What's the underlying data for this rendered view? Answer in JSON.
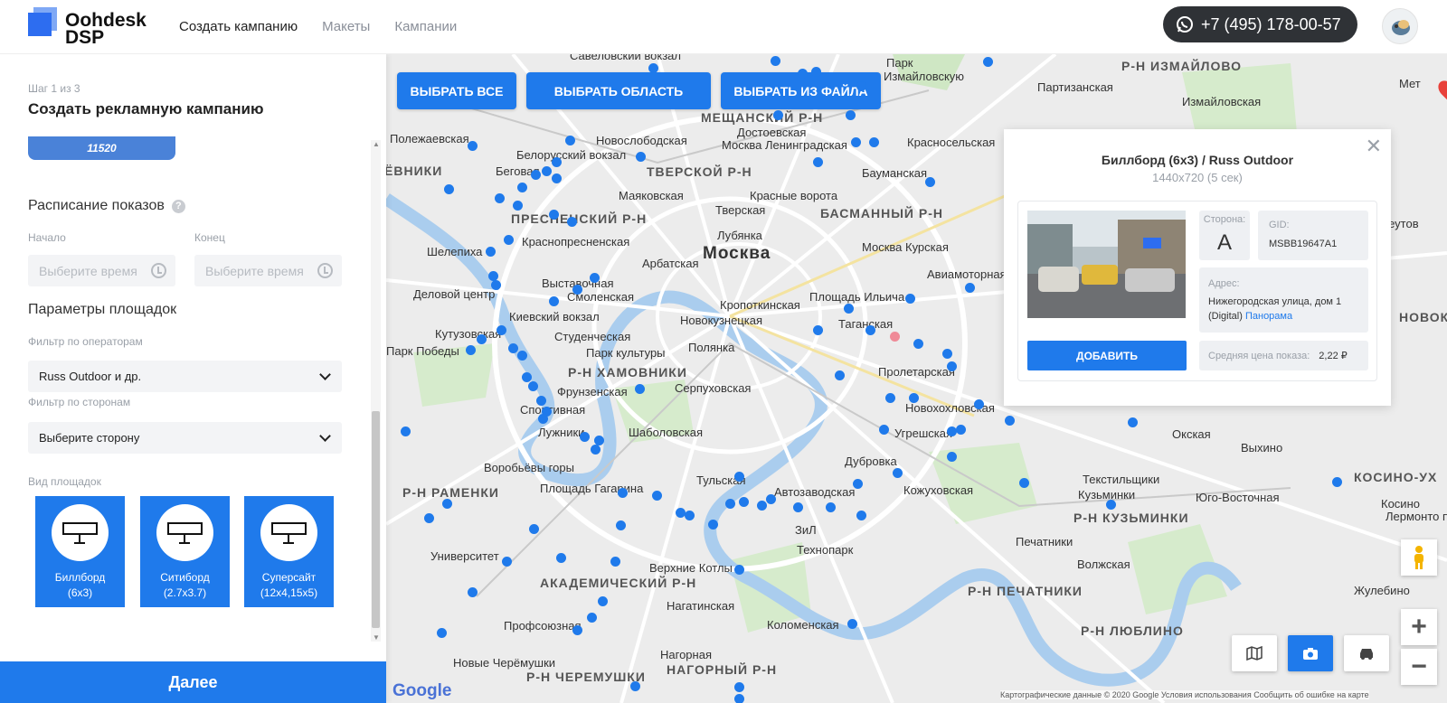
{
  "header": {
    "logo_line1": "Oohdesk",
    "logo_line2": "DSP",
    "nav": [
      {
        "label": "Создать кампанию"
      },
      {
        "label": "Макеты"
      },
      {
        "label": "Кампании"
      }
    ],
    "phone": "+7 (495) 178-00-57"
  },
  "sidebar": {
    "step": "Шаг 1 из 3",
    "title": "Создать рекламную кампанию",
    "budget_value": "11520",
    "schedule": {
      "title": "Расписание показов",
      "start_label": "Начало",
      "end_label": "Конец",
      "start_placeholder": "Выберите время",
      "end_placeholder": "Выберите время"
    },
    "params": {
      "title": "Параметры площадок",
      "operator_label": "Фильтр по операторам",
      "operator_value": "Russ Outdoor и др.",
      "side_label": "Фильтр по сторонам",
      "side_value": "Выберите сторону",
      "types_label": "Вид площадок",
      "types": [
        {
          "line1": "Биллборд",
          "line2": "(6x3)"
        },
        {
          "line1": "Ситиборд",
          "line2": "(2.7x3.7)"
        },
        {
          "line1": "Суперсайт",
          "line2": "(12x4,15x5)"
        }
      ]
    },
    "next_button": "Далее"
  },
  "map": {
    "buttons": {
      "select_all": "ВЫБРАТЬ ВСЕ",
      "select_area": "ВЫБРАТЬ ОБЛАСТЬ",
      "select_file": "ВЫБРАТЬ ИЗ ФАЙЛА"
    },
    "labels": [
      {
        "text": "Савеловский вокзал",
        "kind": "station"
      },
      {
        "text": "Р-Н ИЗМАЙЛОВО",
        "kind": "district"
      },
      {
        "text": "Парк",
        "kind": "station"
      },
      {
        "text": "Измайловскую",
        "kind": "station"
      },
      {
        "text": "Партизанская",
        "kind": "station"
      },
      {
        "text": "Измайловская",
        "kind": "station"
      },
      {
        "text": "МЕЩАНСКИЙ Р-Н",
        "kind": "district"
      },
      {
        "text": "Полежаевская",
        "kind": "station"
      },
      {
        "text": "Новослободская",
        "kind": "station"
      },
      {
        "text": "Достоевская",
        "kind": "station"
      },
      {
        "text": "Белорусский вокзал",
        "kind": "station"
      },
      {
        "text": "Москва Ленинградская",
        "kind": "station"
      },
      {
        "text": "Красносельская",
        "kind": "station"
      },
      {
        "text": "ЁВНИКИ",
        "kind": "district"
      },
      {
        "text": "Беговая",
        "kind": "station"
      },
      {
        "text": "ТВЕРСКОЙ Р-Н",
        "kind": "district"
      },
      {
        "text": "Бауманская",
        "kind": "station"
      },
      {
        "text": "Маяковская",
        "kind": "station"
      },
      {
        "text": "Красные ворота",
        "kind": "station"
      },
      {
        "text": "Тверская",
        "kind": "station"
      },
      {
        "text": "ПРЕСНЕНСКИЙ Р-Н",
        "kind": "district"
      },
      {
        "text": "БАСМАННЫЙ Р-Н",
        "kind": "district"
      },
      {
        "text": "Лубянка",
        "kind": "station"
      },
      {
        "text": "Краснопресненская",
        "kind": "station"
      },
      {
        "text": "Москва",
        "kind": "city"
      },
      {
        "text": "Москва Курская",
        "kind": "station"
      },
      {
        "text": "Шелепиха",
        "kind": "station"
      },
      {
        "text": "Арбатская",
        "kind": "station"
      },
      {
        "text": "Авиамоторная",
        "kind": "station"
      },
      {
        "text": "Выставочная",
        "kind": "station"
      },
      {
        "text": "Деловой центр",
        "kind": "station"
      },
      {
        "text": "Смоленская",
        "kind": "station"
      },
      {
        "text": "Кропоткинская",
        "kind": "station"
      },
      {
        "text": "Площадь Ильича",
        "kind": "station"
      },
      {
        "text": "Киевский вокзал",
        "kind": "station"
      },
      {
        "text": "Новокузнецкая",
        "kind": "station"
      },
      {
        "text": "Кутузовская",
        "kind": "station"
      },
      {
        "text": "Студенческая",
        "kind": "station"
      },
      {
        "text": "Таганская",
        "kind": "station"
      },
      {
        "text": "Парк Победы",
        "kind": "station"
      },
      {
        "text": "Парк культуры",
        "kind": "station"
      },
      {
        "text": "Полянка",
        "kind": "station"
      },
      {
        "text": "Р-Н ХАМОВНИКИ",
        "kind": "district"
      },
      {
        "text": "Пролетарская",
        "kind": "station"
      },
      {
        "text": "Фрунзенская",
        "kind": "station"
      },
      {
        "text": "Серпуховская",
        "kind": "station"
      },
      {
        "text": "Новохохловская",
        "kind": "station"
      },
      {
        "text": "Спортивная",
        "kind": "station"
      },
      {
        "text": "Лужники",
        "kind": "station"
      },
      {
        "text": "Шаболовская",
        "kind": "station"
      },
      {
        "text": "Угрешская",
        "kind": "station"
      },
      {
        "text": "Окская",
        "kind": "station"
      },
      {
        "text": "Дубровка",
        "kind": "station"
      },
      {
        "text": "Выхино",
        "kind": "station"
      },
      {
        "text": "Воробьёвы горы",
        "kind": "station"
      },
      {
        "text": "Тульская",
        "kind": "station"
      },
      {
        "text": "Текстильщики",
        "kind": "station"
      },
      {
        "text": "КОСИНО-УХ",
        "kind": "district"
      },
      {
        "text": "Р-Н РАМЕНКИ",
        "kind": "district"
      },
      {
        "text": "Площадь Гагарина",
        "kind": "station"
      },
      {
        "text": "Автозаводская",
        "kind": "station"
      },
      {
        "text": "Кожуховская",
        "kind": "station"
      },
      {
        "text": "Кузьминки",
        "kind": "station"
      },
      {
        "text": "Юго-Восточная",
        "kind": "station"
      },
      {
        "text": "Р-Н КУЗЬМИНКИ",
        "kind": "district"
      },
      {
        "text": "ЗиЛ",
        "kind": "station"
      },
      {
        "text": "Технопарк",
        "kind": "station"
      },
      {
        "text": "Университет",
        "kind": "station"
      },
      {
        "text": "Печатники",
        "kind": "station"
      },
      {
        "text": "Верхние Котлы",
        "kind": "station"
      },
      {
        "text": "Волжская",
        "kind": "station"
      },
      {
        "text": "АКАДЕМИЧЕСКИЙ Р-Н",
        "kind": "district"
      },
      {
        "text": "Р-Н ПЕЧАТНИКИ",
        "kind": "district"
      },
      {
        "text": "Нагатинская",
        "kind": "station"
      },
      {
        "text": "Жулебино",
        "kind": "station"
      },
      {
        "text": "Профсоюзная",
        "kind": "station"
      },
      {
        "text": "Коломенская",
        "kind": "station"
      },
      {
        "text": "Р-Н ЛЮБЛИНО",
        "kind": "district"
      },
      {
        "text": "Нагорная",
        "kind": "station"
      },
      {
        "text": "Новые Черёмушки",
        "kind": "station"
      },
      {
        "text": "Р-Н ЧЕРЕМУШКИ",
        "kind": "district"
      },
      {
        "text": "НАГОРНЫЙ Р-Н",
        "kind": "district"
      },
      {
        "text": "Реутов",
        "kind": "station"
      },
      {
        "text": "НОВОКО",
        "kind": "district"
      },
      {
        "text": "Косино",
        "kind": "station"
      },
      {
        "text": "Лермонто проспект",
        "kind": "station"
      },
      {
        "text": "Мет",
        "kind": "station"
      }
    ]
  },
  "popup": {
    "title": "Биллборд (6х3) / Russ Outdoor",
    "subtitle": "1440x720 (5 сек)",
    "side_label": "Сторона:",
    "side_value": "A",
    "gid_label": "GID:",
    "gid_value": "MSBB19647A1",
    "address_label": "Адрес:",
    "address_value": "Нижегородская улица, дом 1 (Digital)",
    "panorama_link": "Панорама",
    "add_button": "ДОБАВИТЬ",
    "price_label": "Средняя цена показа:",
    "price_value": "2,22 ₽"
  },
  "map_footer": {
    "google": "Google",
    "attribution": "Картографические данные © 2020 Google    Условия использования    Сообщить об ошибке на карте"
  }
}
